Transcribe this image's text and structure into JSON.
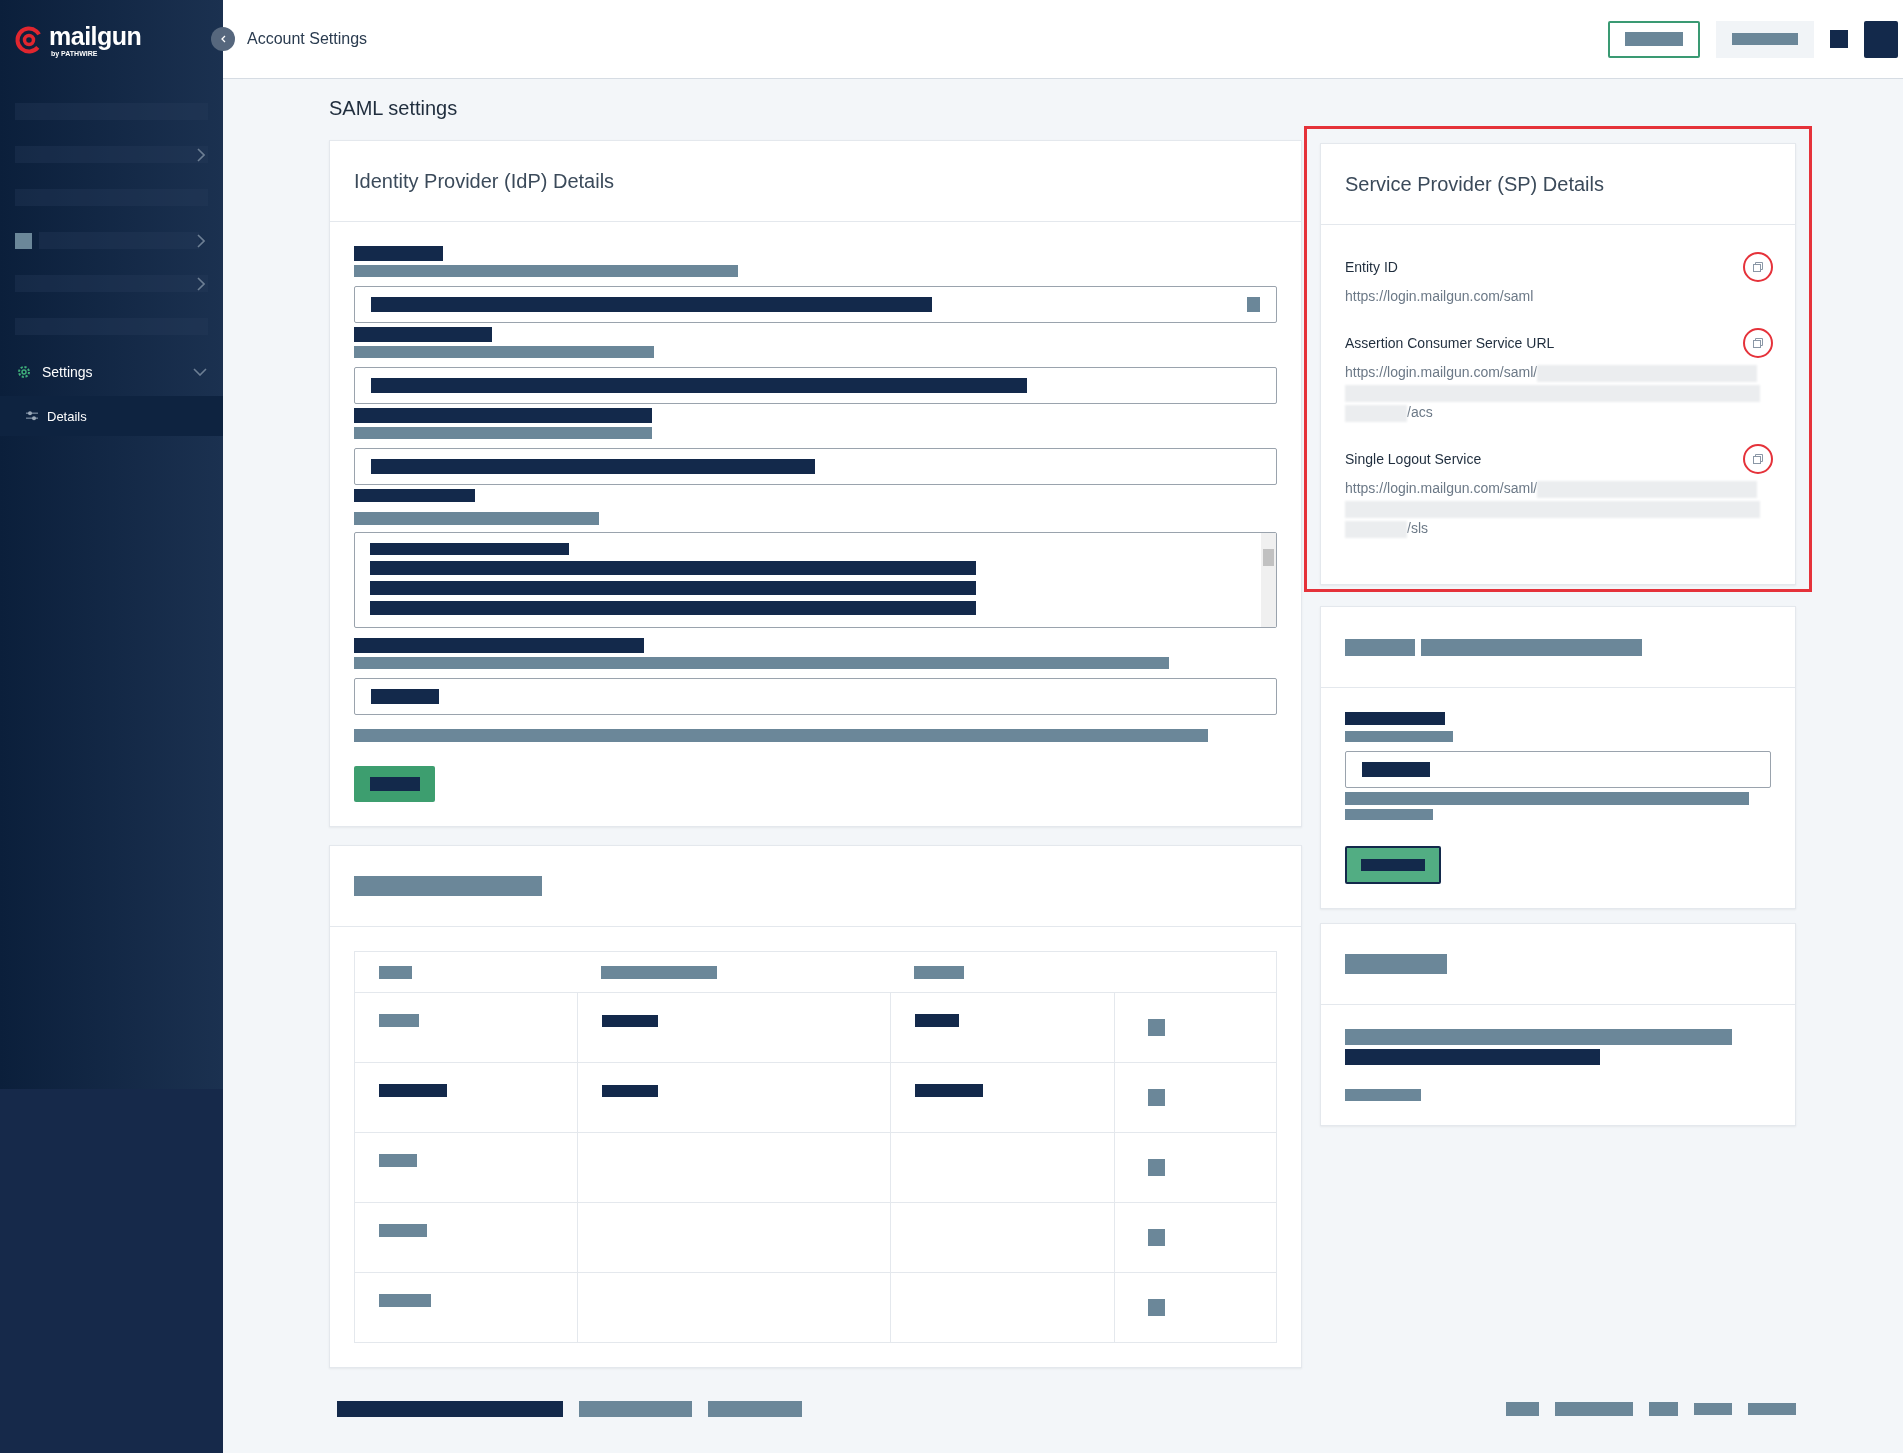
{
  "sidebar": {
    "logo": {
      "name": "mailgun",
      "tagline": "by PATHWIRE"
    },
    "items": [
      {
        "label": "Settings",
        "expanded": true,
        "children": [
          {
            "label": "Details",
            "selected": true
          }
        ]
      }
    ]
  },
  "header": {
    "breadcrumb": "Account Settings"
  },
  "page_title": "SAML settings",
  "idp_card": {
    "title": "Identity Provider (IdP) Details"
  },
  "sp_card": {
    "title": "Service Provider (SP) Details",
    "highlighted": true,
    "fields": [
      {
        "label": "Entity ID",
        "url": "https://login.mailgun.com/saml",
        "blurred": false
      },
      {
        "label": "Assertion Consumer Service URL",
        "url": "https://login.mailgun.com/saml/",
        "url_end": "/acs",
        "blurred": true
      },
      {
        "label": "Single Logout Service",
        "url": "https://login.mailgun.com/saml/",
        "url_end": "/sls",
        "blurred": true
      }
    ]
  }
}
